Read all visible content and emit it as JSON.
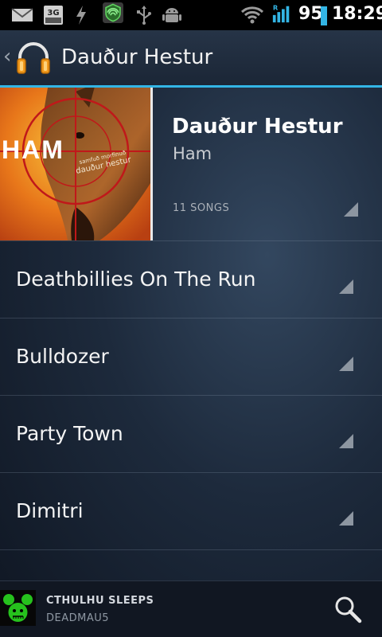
{
  "status_bar": {
    "battery_percent": "95",
    "time": "18:29",
    "icons": [
      "mail-icon",
      "3g-icon",
      "flash-icon",
      "shield-icon",
      "usb-icon",
      "android-icon",
      "wifi-icon",
      "signal-icon",
      "battery-icon"
    ]
  },
  "action_bar": {
    "title": "Dauður Hestur",
    "back_glyph": "‹",
    "app_icon": "headphones-icon"
  },
  "album": {
    "title": "Dauður Hestur",
    "artist": "Ham",
    "song_count": "11 SONGS",
    "art_text": "HAM",
    "art_subtext_1": "dauður hestur",
    "art_subtext_2": "samfuð morfinuð"
  },
  "songs": [
    {
      "title": "Deathbillies On The Run"
    },
    {
      "title": "Bulldozer"
    },
    {
      "title": "Party Town"
    },
    {
      "title": "Dimitri"
    }
  ],
  "now_playing": {
    "title": "CTHULHU SLEEPS",
    "artist": "DEADMAU5"
  },
  "colors": {
    "accent": "#33b5e5",
    "status_bar": "#000000",
    "wifi_green": "#33cc33",
    "battery_cyan": "#33b5e5"
  }
}
